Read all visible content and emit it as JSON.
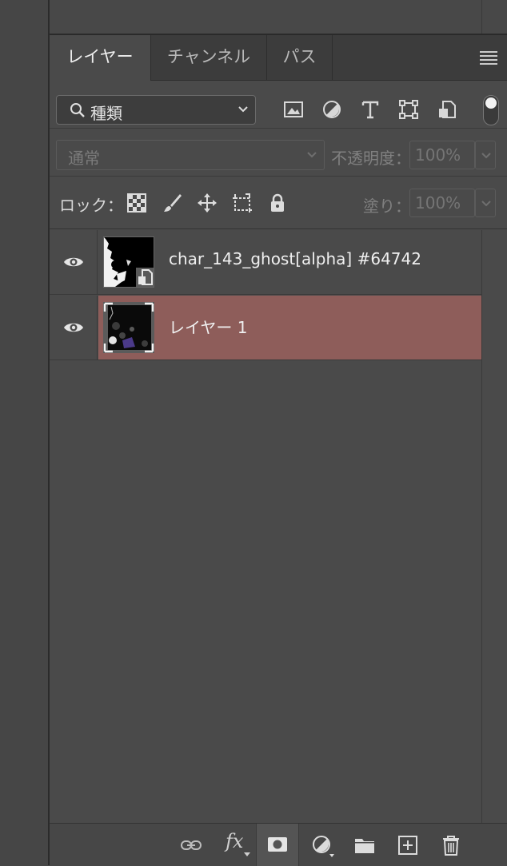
{
  "tabs": [
    {
      "label": "レイヤー",
      "active": true
    },
    {
      "label": "チャンネル",
      "active": false
    },
    {
      "label": "パス",
      "active": false
    }
  ],
  "filter": {
    "kind_label": "種類",
    "icons": [
      "image-filter-icon",
      "adjustment-filter-icon",
      "type-filter-icon",
      "shape-filter-icon",
      "smart-object-filter-icon"
    ]
  },
  "blend": {
    "mode": "通常",
    "opacity_label": "不透明度：",
    "opacity_value": "100%"
  },
  "lock": {
    "label": "ロック：",
    "fill_label": "塗り：",
    "fill_value": "100%"
  },
  "layers": [
    {
      "name": "char_143_ghost[alpha] #64742",
      "visible": true,
      "selected": false,
      "smart_object": true
    },
    {
      "name": "レイヤー 1",
      "visible": true,
      "selected": true,
      "smart_object": false
    }
  ],
  "bottom": {
    "fx_label": "fx"
  },
  "colors": {
    "selected_row": "#8e5d5a",
    "panel_bg": "#4a4a4a",
    "tabbar_bg": "#3c3c3c"
  }
}
